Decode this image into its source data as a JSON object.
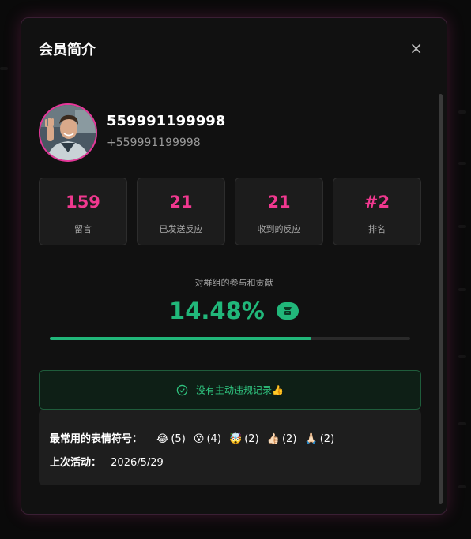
{
  "modal": {
    "title": "会员简介",
    "close_icon": "×"
  },
  "member": {
    "name": "559991199998",
    "phone": "+559991199998",
    "avatar_alt": "member-avatar"
  },
  "stats": [
    {
      "value": "159",
      "label": "留言"
    },
    {
      "value": "21",
      "label": "已发送反应"
    },
    {
      "value": "21",
      "label": "收到的反应"
    },
    {
      "value": "#2",
      "label": "排名"
    }
  ],
  "contribution": {
    "label": "对群组的参与和贡献",
    "percent_text": "14.48%",
    "bar_fraction": 0.725
  },
  "violation": {
    "text": "没有主动违规记录👍"
  },
  "info": {
    "emoji_label": "最常用的表情符号：",
    "emojis": [
      {
        "emoji": "😂",
        "count": "(5)"
      },
      {
        "emoji": "😮",
        "count": "(4)"
      },
      {
        "emoji": "🤯",
        "count": "(2)"
      },
      {
        "emoji": "👍🏻",
        "count": "(2)"
      },
      {
        "emoji": "🙏🏻",
        "count": "(2)"
      }
    ],
    "last_active_label": "上次活动：",
    "last_active_value": "2026/5/29"
  },
  "colors": {
    "accent_pink": "#f0388f",
    "accent_green": "#21b77a",
    "background": "#111111"
  }
}
